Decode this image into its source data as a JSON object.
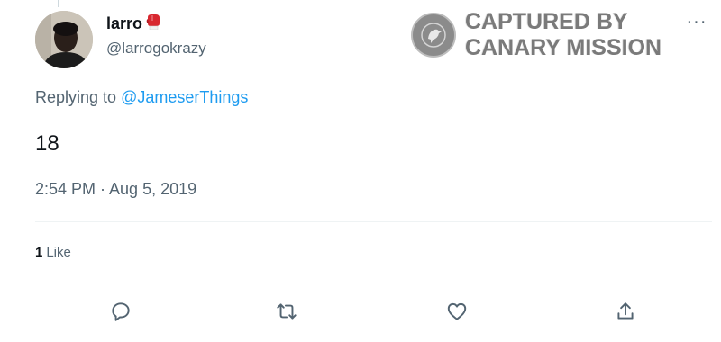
{
  "user": {
    "display_name": "larro",
    "handle": "@larrogokrazy",
    "avatar": "avatar",
    "name_emoji": "boxing-glove-icon"
  },
  "more_menu": "···",
  "watermark": {
    "line1": "CAPTURED BY",
    "line2": "CANARY MISSION",
    "seal_icon": "canary-bird-icon"
  },
  "reply": {
    "prefix": "Replying to ",
    "mention": "@JameserThings"
  },
  "tweet": {
    "text": "18",
    "timestamp": "2:54 PM · Aug 5, 2019"
  },
  "stats": {
    "like_count": "1",
    "like_label": "Like"
  },
  "actions": [
    {
      "icon": "reply-icon"
    },
    {
      "icon": "retweet-icon"
    },
    {
      "icon": "like-icon"
    },
    {
      "icon": "share-icon"
    }
  ],
  "colors": {
    "link": "#1d9bf0",
    "secondary_text": "#536471",
    "primary_text": "#0f1419"
  }
}
